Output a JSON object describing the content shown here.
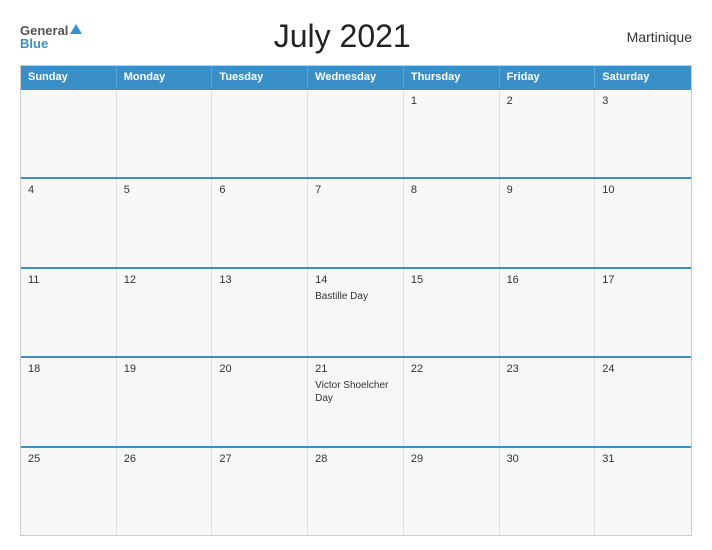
{
  "header": {
    "logo_general": "General",
    "logo_blue": "Blue",
    "title": "July 2021",
    "region": "Martinique"
  },
  "calendar": {
    "weekdays": [
      "Sunday",
      "Monday",
      "Tuesday",
      "Wednesday",
      "Thursday",
      "Friday",
      "Saturday"
    ],
    "weeks": [
      [
        {
          "day": "",
          "event": ""
        },
        {
          "day": "",
          "event": ""
        },
        {
          "day": "",
          "event": ""
        },
        {
          "day": "",
          "event": ""
        },
        {
          "day": "1",
          "event": ""
        },
        {
          "day": "2",
          "event": ""
        },
        {
          "day": "3",
          "event": ""
        }
      ],
      [
        {
          "day": "4",
          "event": ""
        },
        {
          "day": "5",
          "event": ""
        },
        {
          "day": "6",
          "event": ""
        },
        {
          "day": "7",
          "event": ""
        },
        {
          "day": "8",
          "event": ""
        },
        {
          "day": "9",
          "event": ""
        },
        {
          "day": "10",
          "event": ""
        }
      ],
      [
        {
          "day": "11",
          "event": ""
        },
        {
          "day": "12",
          "event": ""
        },
        {
          "day": "13",
          "event": ""
        },
        {
          "day": "14",
          "event": "Bastille Day"
        },
        {
          "day": "15",
          "event": ""
        },
        {
          "day": "16",
          "event": ""
        },
        {
          "day": "17",
          "event": ""
        }
      ],
      [
        {
          "day": "18",
          "event": ""
        },
        {
          "day": "19",
          "event": ""
        },
        {
          "day": "20",
          "event": ""
        },
        {
          "day": "21",
          "event": "Victor Shoelcher Day"
        },
        {
          "day": "22",
          "event": ""
        },
        {
          "day": "23",
          "event": ""
        },
        {
          "day": "24",
          "event": ""
        }
      ],
      [
        {
          "day": "25",
          "event": ""
        },
        {
          "day": "26",
          "event": ""
        },
        {
          "day": "27",
          "event": ""
        },
        {
          "day": "28",
          "event": ""
        },
        {
          "day": "29",
          "event": ""
        },
        {
          "day": "30",
          "event": ""
        },
        {
          "day": "31",
          "event": ""
        }
      ]
    ]
  }
}
